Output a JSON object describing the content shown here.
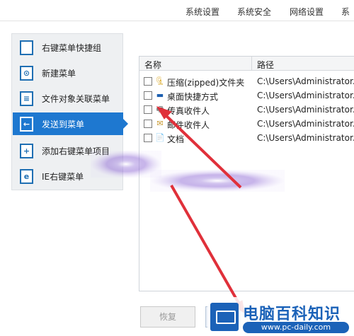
{
  "top_nav": [
    "系统设置",
    "系统安全",
    "网络设置",
    "系"
  ],
  "sidebar": {
    "items": [
      {
        "label": "右键菜单快捷组",
        "glyph": ""
      },
      {
        "label": "新建菜单",
        "glyph": "⊙"
      },
      {
        "label": "文件对象关联菜单",
        "glyph": "≡"
      },
      {
        "label": "发送到菜单",
        "glyph": "←"
      },
      {
        "label": "添加右键菜单项目",
        "glyph": "+"
      },
      {
        "label": "IE右键菜单",
        "glyph": "e"
      }
    ],
    "active_index": 3
  },
  "table": {
    "headers": {
      "name": "名称",
      "path": "路径"
    },
    "rows": [
      {
        "name": "压缩(zipped)文件夹",
        "path": "C:\\Users\\Administrator.I",
        "icon": "🗜"
      },
      {
        "name": "桌面快捷方式",
        "path": "C:\\Users\\Administrator.I",
        "icon": "▬"
      },
      {
        "name": "传真收件人",
        "path": "C:\\Users\\Administrator.I",
        "icon": "🖷"
      },
      {
        "name": "邮件收件人",
        "path": "C:\\Users\\Administrator.I",
        "icon": "✉"
      },
      {
        "name": "文档",
        "path": "C:\\Users\\Administrator.I",
        "icon": "📄"
      }
    ]
  },
  "buttons": {
    "restore": "恢复",
    "apply": ""
  },
  "watermark": {
    "title": "电脑百科知识",
    "url": "www.pc-daily.com"
  },
  "colors": {
    "accent": "#1e78d0",
    "arrow": "#e0303a"
  }
}
